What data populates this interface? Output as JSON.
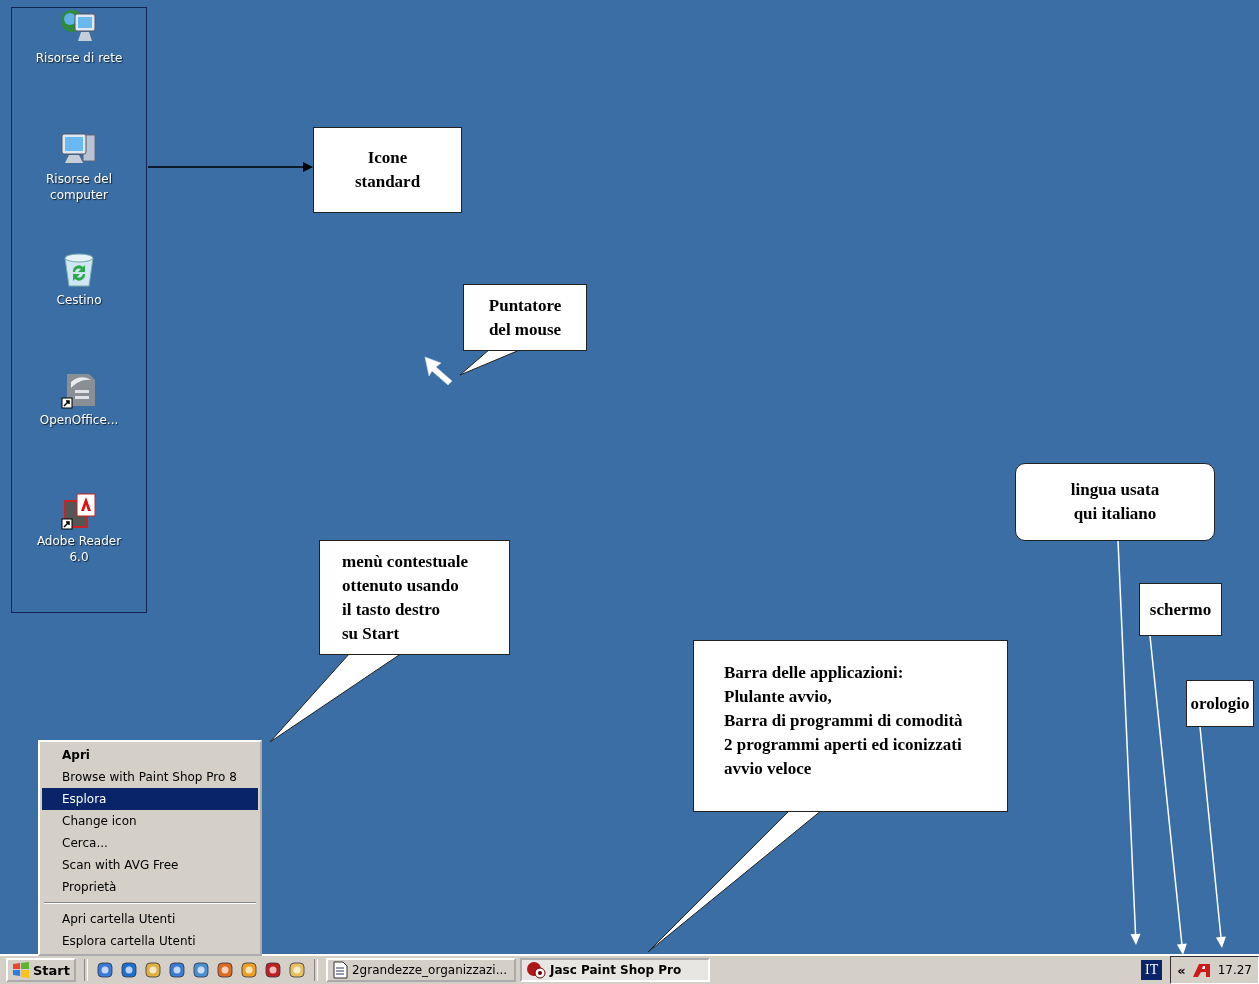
{
  "desktop_icons": [
    {
      "label": "Risorse di rete"
    },
    {
      "label": "Risorse del computer"
    },
    {
      "label": "Cestino"
    },
    {
      "label": "OpenOffice..."
    },
    {
      "label": "Adobe Reader 6.0"
    }
  ],
  "callouts": [
    {
      "kind": "arrow",
      "text": "Icone\nstandard"
    },
    {
      "kind": "bubble",
      "text": "Puntatore\ndel mouse"
    },
    {
      "kind": "bubble",
      "text": "menù contestuale\nottenuto usando\nil tasto destro\nsu Start"
    },
    {
      "kind": "bubble",
      "text": "Barra delle applicazioni:\nPlulante avvio,\n Barra di programmi di comodità\n2 programmi aperti ed iconizzati\navvio veloce"
    },
    {
      "kind": "rounded-line",
      "text": "lingua usata\nqui italiano"
    },
    {
      "kind": "line",
      "text": "schermo"
    },
    {
      "kind": "line",
      "text": "orologio"
    }
  ],
  "context_menu": {
    "groups": [
      [
        {
          "label": "Apri",
          "default": true,
          "selected": false
        },
        {
          "label": "Browse with Paint Shop Pro 8",
          "default": false,
          "selected": false
        },
        {
          "label": "Esplora",
          "default": false,
          "selected": true
        },
        {
          "label": "Change icon",
          "default": false,
          "selected": false
        },
        {
          "label": "Cerca...",
          "default": false,
          "selected": false
        },
        {
          "label": "Scan with AVG Free",
          "default": false,
          "selected": false
        },
        {
          "label": "Proprietà",
          "default": false,
          "selected": false
        }
      ],
      [
        {
          "label": "Apri cartella Utenti",
          "default": false,
          "selected": false
        },
        {
          "label": "Esplora cartella Utenti",
          "default": false,
          "selected": false
        }
      ]
    ]
  },
  "taskbar": {
    "start": "Start",
    "tasks": [
      {
        "label": "2grandezze_organizzazi...",
        "selected": false
      },
      {
        "label": "Jasc Paint Shop Pro",
        "selected": true
      }
    ],
    "language": "IT",
    "tray_toggle": "«",
    "clock": "17.27"
  }
}
